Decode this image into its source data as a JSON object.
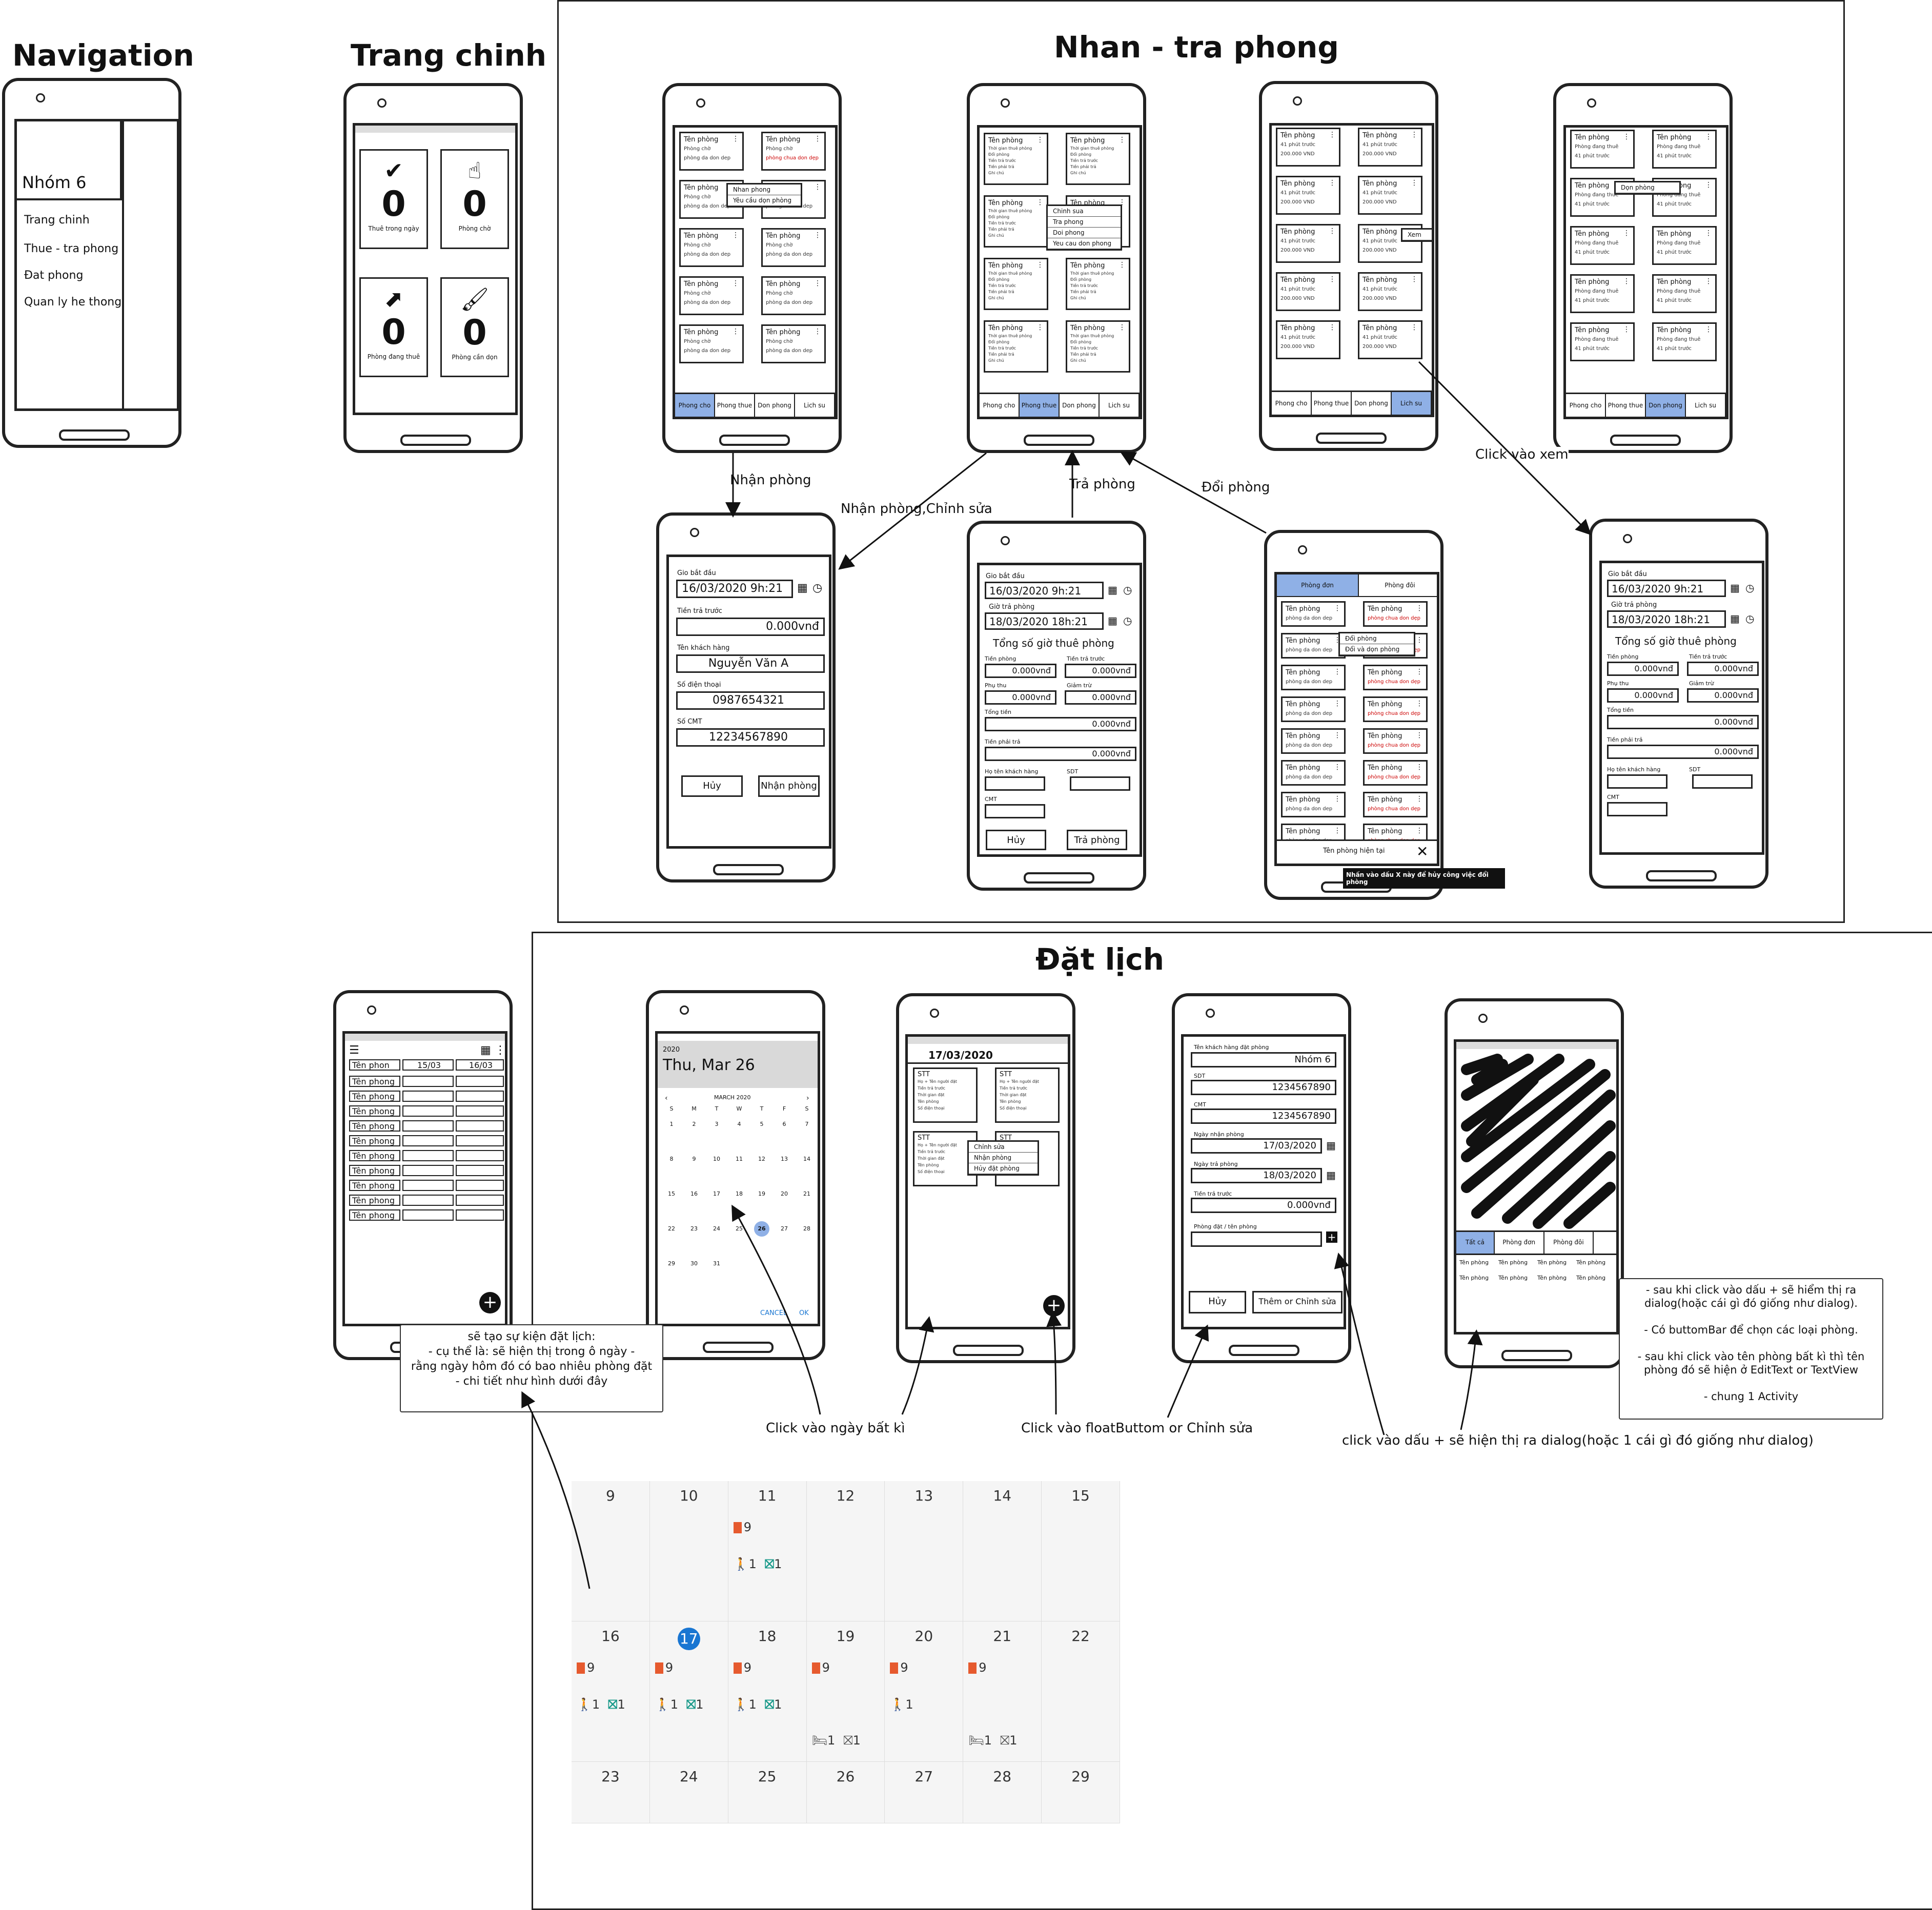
{
  "titles": {
    "navigation": "Navigation",
    "home": "Trang chinh",
    "checkin": "Nhan - tra phong",
    "booking": "Đặt lịch"
  },
  "nav_drawer": {
    "group": "Nhóm 6",
    "items": [
      "Trang chinh",
      "Thue - tra phong",
      "Đat phong",
      "Quan ly he thong"
    ]
  },
  "home_stats": [
    {
      "icon": "check-icon",
      "value": "0",
      "label": "Thuê trong ngày"
    },
    {
      "icon": "hand-pointer-icon",
      "value": "0",
      "label": "Phòng chờ"
    },
    {
      "icon": "arrow-out-icon",
      "value": "0",
      "label": "Phòng đang thuê"
    },
    {
      "icon": "brush-icon",
      "value": "0",
      "label": "Phòng cần dọn"
    }
  ],
  "room_card": {
    "name": "Tên phòng",
    "status_wait": "Phòng chờ",
    "status_clean": "phòng da don dep",
    "status_dirty": "phòng chua don dẹp",
    "rent_time": "Thời gian thuê phòng",
    "rent_lines": [
      "Thời gian thuê phòng",
      "Đổi phòng",
      "Tiền trả trước",
      "Tiền phải trả",
      "Ghi chú"
    ],
    "renting": "Phòng đang thuê",
    "minutes": "41 phút trước",
    "price": "200.000 VND"
  },
  "tabs_room": [
    "Phong cho",
    "Phong thue",
    "Don phong",
    "Lich su"
  ],
  "ctx_menu_wait": [
    "Nhan phong",
    "Yêu cầu dọn phòng"
  ],
  "ctx_menu_rent": [
    "Chinh sua",
    "Tra phong",
    "Doi phong",
    "Yeu cau don phong"
  ],
  "ctx_history": "Xem",
  "ctx_clean": "Dọn phòng",
  "ctx_swap": [
    "Đổi phòng",
    "Đổi và dọn phòng"
  ],
  "checkin_form": {
    "start_label": "Gio bắt đầu",
    "start": "16/03/2020   9h:21",
    "prepaid_label": "Tiền trả trước",
    "prepaid": "0.000vnđ",
    "customer_label": "Tên khách hàng",
    "customer": "Nguyễn Văn A",
    "phone_label": "Số điện thoại",
    "phone": "0987654321",
    "id_label": "Số CMT",
    "id": "12234567890",
    "cancel": "Hủy",
    "submit": "Nhận phòng"
  },
  "checkout_form": {
    "start_label": "Gio bắt đầu",
    "start": "16/03/2020   9h:21",
    "end_label": "Giờ trả phòng",
    "end": "18/03/2020   18h:21",
    "total_time": "Tổng số giờ thuê phòng",
    "room_label": "Tiền phòng",
    "prepaid_label": "Tiền trả trước",
    "surcharge_label": "Phụ thu",
    "discount_label": "Giảm trừ",
    "total_label": "Tổng tiền",
    "due_label": "Tiền phải trả",
    "money": "0.000vnđ",
    "name_label": "Họ tên khách hàng",
    "sdt_label": "SDT",
    "cmt_label": "CMT",
    "cancel": "Hủy",
    "submit": "Trả phòng"
  },
  "swap_screen": {
    "tab_a": "Phòng đơn",
    "tab_b": "Phòng đôi",
    "current": "Tên phòng hiện tại",
    "close_tip": "Nhấn vào dấu X này để hủy công việc đổi phòng"
  },
  "flow_labels": {
    "nhan_phong": "Nhận phòng",
    "nhan_chinh_sua": "Nhận phòng,Chỉnh sửa",
    "tra_phong": "Trả phòng",
    "doi_phong": "Đổi phòng",
    "click_xem": "Click vào xem"
  },
  "booking_list": {
    "col_name": "Tên phon",
    "col_a": "15/03",
    "col_b": "16/03",
    "row": "Tên phong",
    "row_count": 10
  },
  "datepicker": {
    "year": "2020",
    "date": "Thu, Mar 26",
    "month": "MARCH 2020",
    "weekdays": [
      "S",
      "M",
      "T",
      "W",
      "T",
      "F",
      "S"
    ],
    "weeks": [
      [
        "1",
        "2",
        "3",
        "4",
        "5",
        "6",
        "7"
      ],
      [
        "8",
        "9",
        "10",
        "11",
        "12",
        "13",
        "14"
      ],
      [
        "15",
        "16",
        "17",
        "18",
        "19",
        "20",
        "21"
      ],
      [
        "22",
        "23",
        "24",
        "25",
        "26",
        "27",
        "28"
      ],
      [
        "29",
        "30",
        "31",
        "",
        "",
        "",
        ""
      ]
    ],
    "selected": "26",
    "cancel": "CANCEL",
    "ok": "OK"
  },
  "day_screen": {
    "date": "17/03/2020",
    "card_title": "STT",
    "lines": [
      "Họ + Tên người đặt",
      "Tiền trả trước",
      "Thời gian đặt",
      "Tên phòng",
      "Số điện thoại"
    ],
    "menu": [
      "Chỉnh sửa",
      "Nhận phòng",
      "Hủy đặt phòng"
    ]
  },
  "booking_form": {
    "name_label": "Tên khách hàng đặt phòng",
    "name": "Nhóm 6",
    "sdt_label": "SDT",
    "sdt": "1234567890",
    "cmt_label": "CMT",
    "cmt": "1234567890",
    "in_label": "Ngày nhận phòng",
    "in": "17/03/2020",
    "out_label": "Ngày trả phòng",
    "out": "18/03/2020",
    "prepaid_label": "Tiền trả trước",
    "prepaid": "0.000vnđ",
    "room_label": "Phòng đặt / tên phòng",
    "cancel": "Hủy",
    "submit": "Thêm or Chỉnh sửa"
  },
  "room_picker": {
    "tabs": [
      "Tất cả",
      "Phòng đơn",
      "Phòng đôi"
    ],
    "item": "Tên phòng"
  },
  "notes": {
    "calendar": "sẽ tạo sự kiện đặt lịch:\n- cụ thể là: sẽ hiện thị trong ô ngày -\nrằng ngày hôm đó có bao nhiêu phòng đặt\n- chi tiết như hình dưới đây",
    "dialog": "- sau khi click vào dấu + sẽ hiểm thị ra\ndialog(hoặc cái gì đó giống như dialog).\n\n- Có buttomBar để chọn các loại phòng.\n\n- sau khi click vào tên phòng bất kì thì tên\nphòng đó sẽ hiện ở EditText or TextView\n\n- chung 1 Activity",
    "click_day": "Click vào ngày bất kì",
    "click_fab": "Click vào floatButtom or Chỉnh sửa",
    "click_plus": "click vào dấu + sẽ hiện thị ra dialog(hoặc 1 cái gì đó giống như dialog)"
  },
  "month_grid": {
    "rows": [
      [
        "9",
        "10",
        "11",
        "12",
        "13",
        "14",
        "15"
      ],
      [
        "16",
        "17",
        "18",
        "19",
        "20",
        "21",
        "22"
      ],
      [
        "23",
        "24",
        "25",
        "26",
        "27",
        "28",
        "29"
      ]
    ],
    "today": "17",
    "count": "9",
    "one": "1"
  },
  "colors": {
    "accent": "#8fb0e6",
    "today": "#1976d2",
    "door": "#e65a2e",
    "walk": "#1a9a8a",
    "warn": "#c00000"
  }
}
